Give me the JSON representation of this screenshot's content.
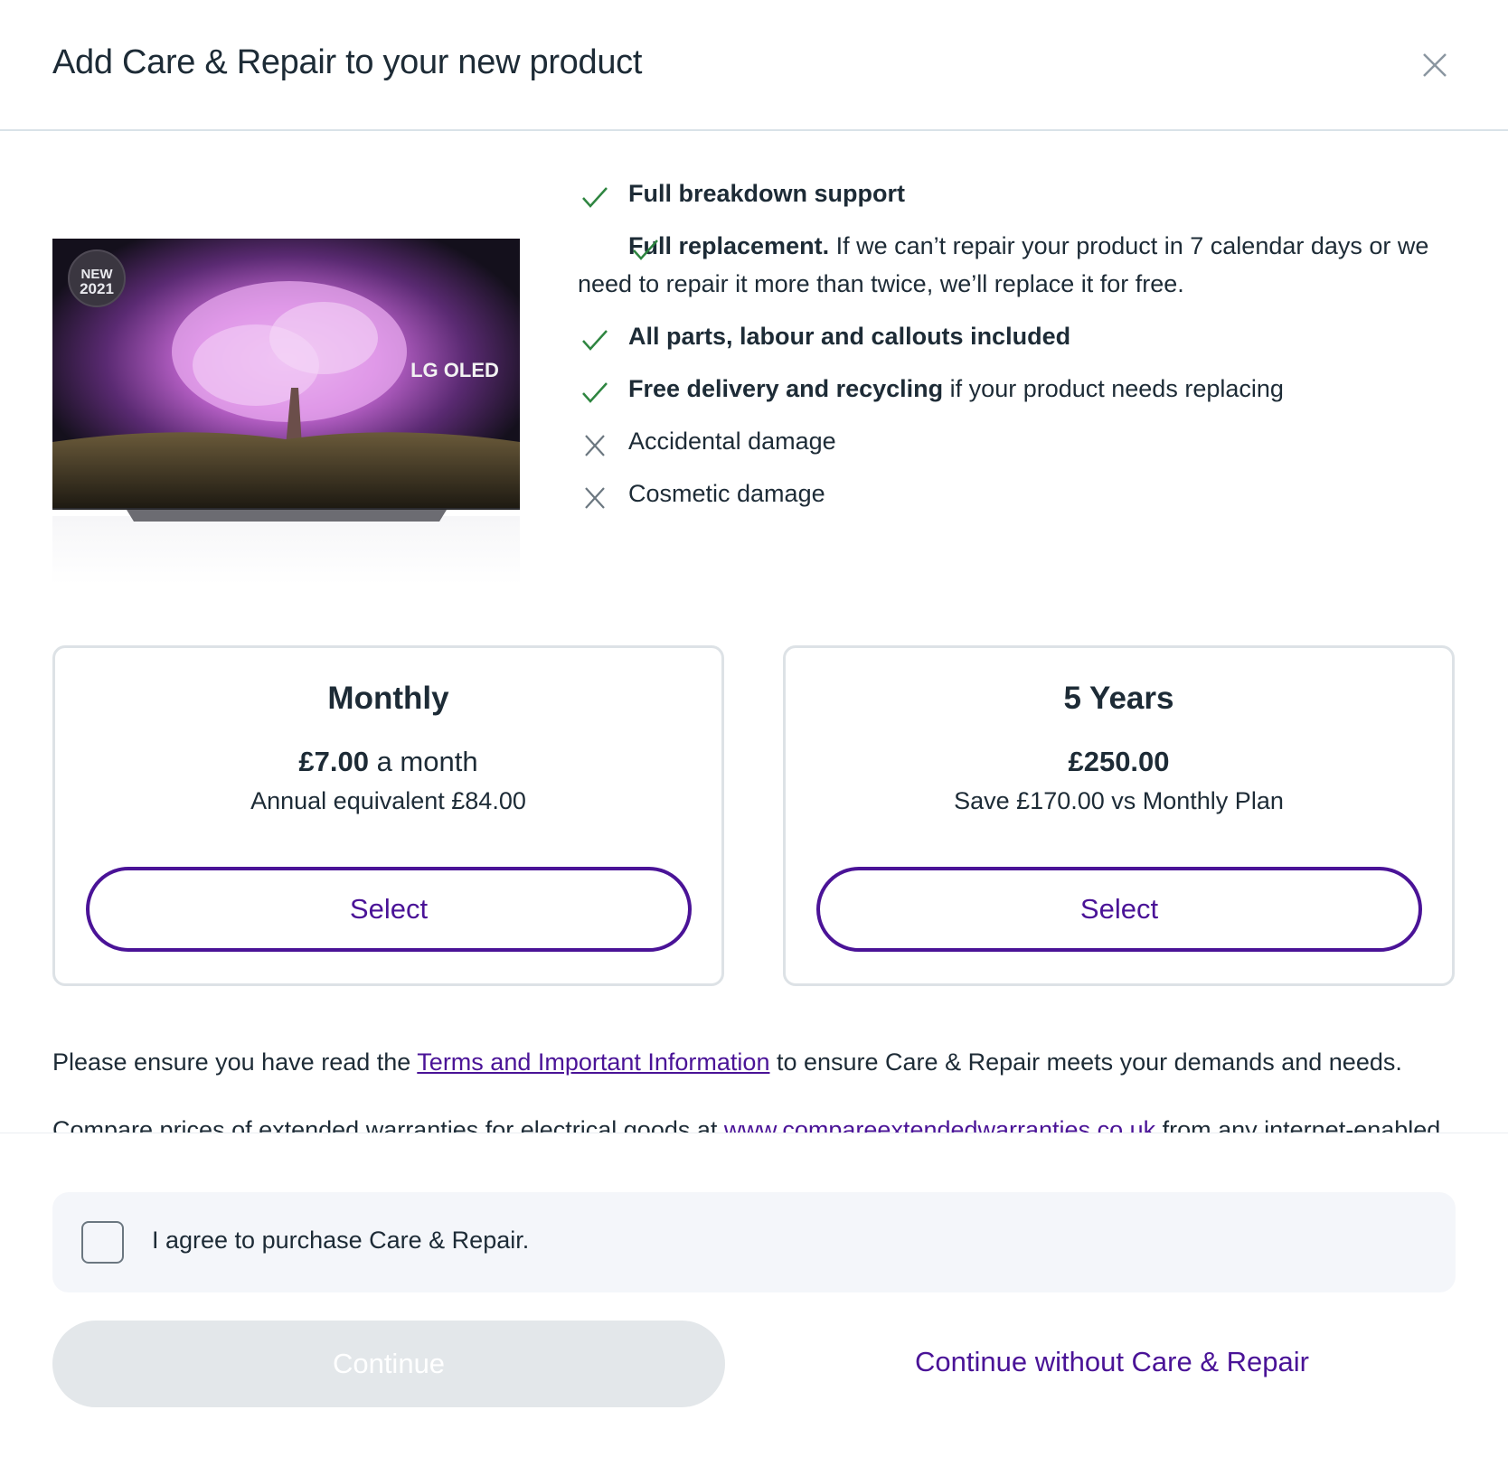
{
  "header": {
    "title": "Add Care & Repair to your new product"
  },
  "product": {
    "badge_line1": "NEW",
    "badge_line2": "2021",
    "brand_label": "LG OLED"
  },
  "features": [
    {
      "status": "included",
      "bold": "Full breakdown support",
      "text": ""
    },
    {
      "status": "included",
      "bold": "Full replacement.",
      "text": " If we can’t repair your product in 7 calendar days or we need to repair it more than twice, we’ll replace it for free."
    },
    {
      "status": "included",
      "bold": "All parts, labour and callouts included",
      "text": ""
    },
    {
      "status": "included",
      "bold": "Free delivery and recycling",
      "text": " if your product needs replacing"
    },
    {
      "status": "excluded",
      "bold": "",
      "text": "Accidental damage"
    },
    {
      "status": "excluded",
      "bold": "",
      "text": "Cosmetic damage"
    }
  ],
  "plans": {
    "monthly": {
      "title": "Monthly",
      "price": "£7.00",
      "price_suffix": " a month",
      "sub": "Annual equivalent £84.00",
      "button": "Select"
    },
    "five_years": {
      "title": "5 Years",
      "price": "£250.00",
      "price_suffix": "",
      "sub": "Save £170.00 vs Monthly Plan",
      "button": "Select"
    }
  },
  "terms": {
    "before": "Please ensure you have read the ",
    "link": "Terms and Important Information",
    "after": " to ensure Care & Repair meets your demands and needs."
  },
  "compare": {
    "before": "Compare prices of extended warranties for electrical goods at ",
    "link": "www.compareextendedwarranties.co.uk",
    "after": " from any internet-enabled"
  },
  "footer": {
    "agree_label": "I agree to purchase Care & Repair.",
    "agree_checked": false,
    "continue_label": "Continue",
    "continue_without_label": "Continue without Care & Repair"
  },
  "colors": {
    "brand_purple": "#4a1397",
    "check_green": "#2e8540",
    "cross_grey": "#6b7780",
    "text_dark": "#1d2b36"
  }
}
